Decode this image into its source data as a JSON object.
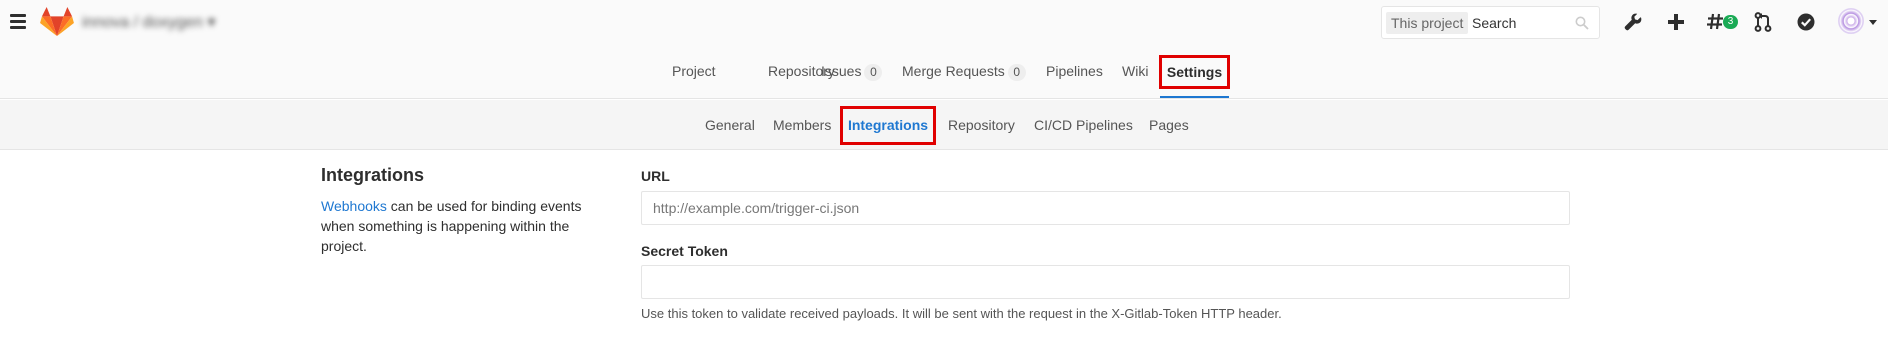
{
  "header": {
    "project_path": "innova / doxygen",
    "search": {
      "scope": "This project",
      "placeholder": "Search"
    },
    "todos_count": "3"
  },
  "project_nav": {
    "project": "Project",
    "repository": "Repository",
    "issues": "Issues",
    "issues_count": "0",
    "merge_requests": "Merge Requests",
    "merge_requests_count": "0",
    "pipelines": "Pipelines",
    "wiki": "Wiki",
    "settings": "Settings"
  },
  "settings_nav": {
    "general": "General",
    "members": "Members",
    "integrations": "Integrations",
    "repository": "Repository",
    "cicd": "CI/CD Pipelines",
    "pages": "Pages"
  },
  "integrations": {
    "title": "Integrations",
    "desc_link": "Webhooks",
    "desc_rest": " can be used for binding events when something is happening within the project.",
    "url_label": "URL",
    "url_placeholder": "http://example.com/trigger-ci.json",
    "token_label": "Secret Token",
    "token_placeholder": "",
    "token_help": "Use this token to validate received payloads. It will be sent with the request in the X-Gitlab-Token HTTP header."
  },
  "colors": {
    "accent": "#1f78d1",
    "highlight_box": "#e00000",
    "badge_green": "#1aaa55"
  }
}
